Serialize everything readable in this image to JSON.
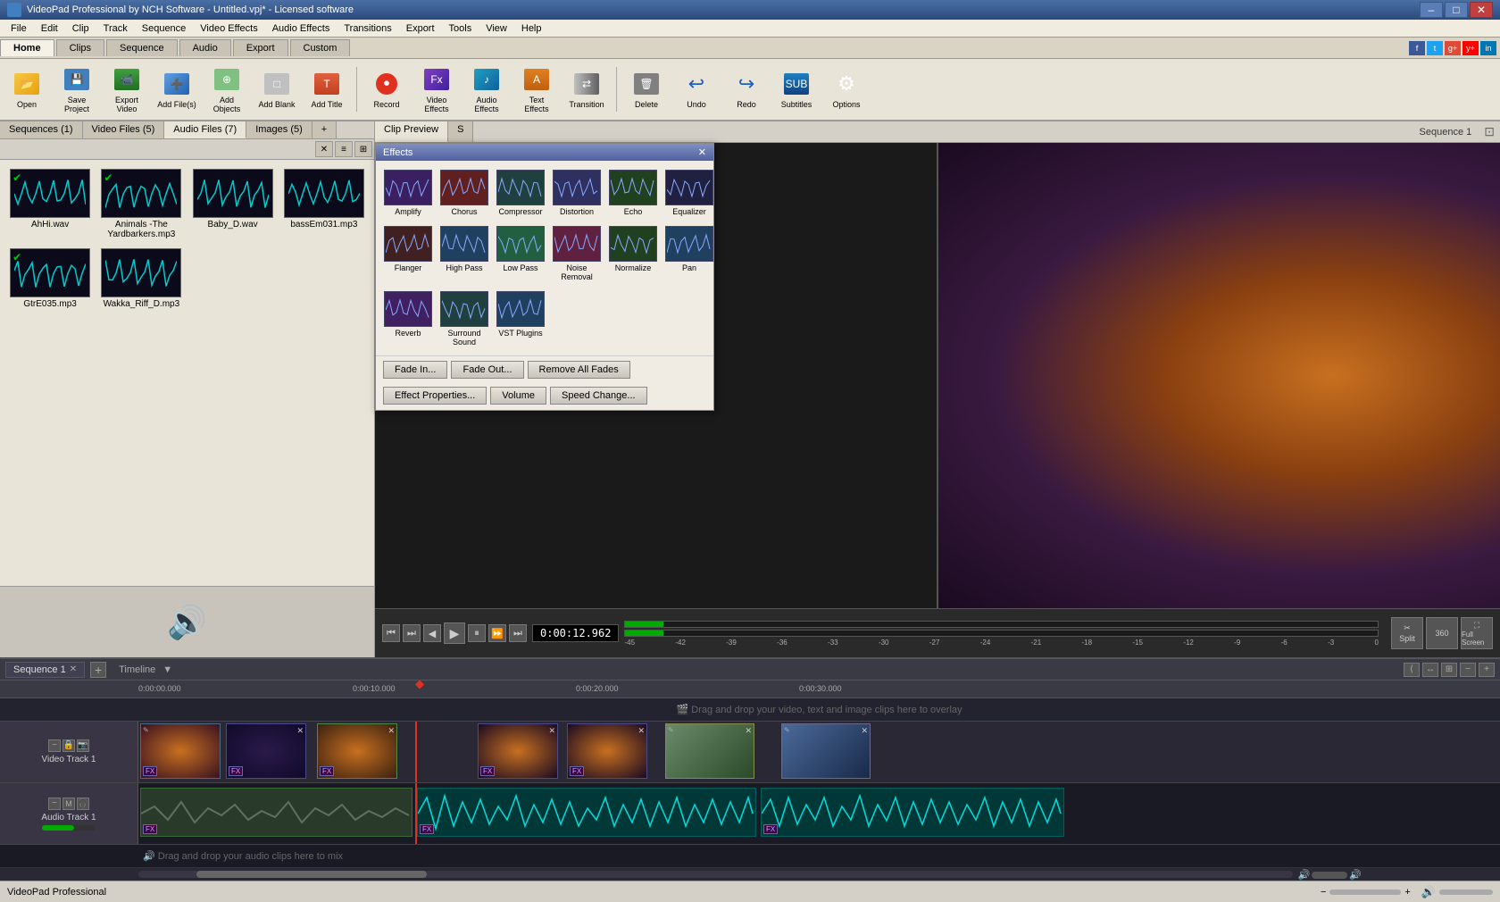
{
  "app": {
    "title": "VideoPad Professional by NCH Software - Untitled.vpj* - Licensed software",
    "status_text": "VideoPad Professional"
  },
  "titlebar": {
    "title": "VideoPad Professional by NCH Software - Untitled.vpj* - Licensed software",
    "min": "–",
    "max": "□",
    "close": "✕"
  },
  "menubar": {
    "items": [
      "File",
      "Edit",
      "Clip",
      "Track",
      "Sequence",
      "Video Effects",
      "Audio Effects",
      "Transitions",
      "Export",
      "Tools",
      "View",
      "Help"
    ]
  },
  "toolbar_tabs": {
    "tabs": [
      "Home",
      "Clips",
      "Sequence",
      "Audio",
      "Export",
      "Custom"
    ],
    "active": "Home"
  },
  "toolbar": {
    "buttons": [
      {
        "id": "open",
        "label": "Open",
        "icon": "open"
      },
      {
        "id": "save-project",
        "label": "Save Project",
        "icon": "save"
      },
      {
        "id": "export-video",
        "label": "Export Video",
        "icon": "export-v"
      },
      {
        "id": "add-files",
        "label": "Add File(s)",
        "icon": "add-files"
      },
      {
        "id": "add-objects",
        "label": "Add Objects",
        "icon": "add-obj"
      },
      {
        "id": "add-blank",
        "label": "Add Blank",
        "icon": "add-blank"
      },
      {
        "id": "add-title",
        "label": "Add Title",
        "icon": "add-title"
      },
      {
        "id": "record",
        "label": "Record",
        "icon": "record"
      },
      {
        "id": "video-effects",
        "label": "Video Effects",
        "icon": "video-fx"
      },
      {
        "id": "audio-effects",
        "label": "Audio Effects",
        "icon": "audio-fx"
      },
      {
        "id": "text-effects",
        "label": "Text Effects",
        "icon": "text-fx"
      },
      {
        "id": "transition",
        "label": "Transition",
        "icon": "transition"
      },
      {
        "id": "delete",
        "label": "Delete",
        "icon": "delete"
      },
      {
        "id": "undo",
        "label": "Undo",
        "icon": "undo"
      },
      {
        "id": "redo",
        "label": "Redo",
        "icon": "redo"
      },
      {
        "id": "subtitles",
        "label": "Subtitles",
        "icon": "subtitles"
      },
      {
        "id": "options",
        "label": "Options",
        "icon": "options"
      }
    ]
  },
  "file_panel": {
    "tabs": [
      {
        "id": "sequences",
        "label": "Sequences (1)"
      },
      {
        "id": "video-files",
        "label": "Video Files (5)"
      },
      {
        "id": "audio-files",
        "label": "Audio Files (7)",
        "active": true
      },
      {
        "id": "images",
        "label": "Images (5)"
      },
      {
        "id": "add",
        "label": "+"
      }
    ],
    "files": [
      {
        "name": "AhHi.wav",
        "type": "audio",
        "checked": true
      },
      {
        "name": "Animals -The Yardbarkers.mp3",
        "type": "audio",
        "checked": true
      },
      {
        "name": "Baby_D.wav",
        "type": "audio",
        "checked": false
      },
      {
        "name": "bassEm031.mp3",
        "type": "audio",
        "checked": false
      },
      {
        "name": "GtrE035.mp3",
        "type": "audio",
        "checked": true
      },
      {
        "name": "Wakka_Riff_D.mp3",
        "type": "audio",
        "checked": false
      }
    ]
  },
  "effects_popup": {
    "title": "Effects",
    "effects": [
      {
        "name": "Amplify",
        "color": "#3a2060"
      },
      {
        "name": "Chorus",
        "color": "#602020"
      },
      {
        "name": "Compressor",
        "color": "#204040"
      },
      {
        "name": "Distortion",
        "color": "#303060"
      },
      {
        "name": "Echo",
        "color": "#204020"
      },
      {
        "name": "Equalizer",
        "color": "#202040"
      },
      {
        "name": "Flanger",
        "color": "#402020"
      },
      {
        "name": "High Pass",
        "color": "#204060"
      },
      {
        "name": "Low Pass",
        "color": "#206040"
      },
      {
        "name": "Noise Removal",
        "color": "#602040"
      },
      {
        "name": "Normalize",
        "color": "#204020"
      },
      {
        "name": "Pan",
        "color": "#204060"
      },
      {
        "name": "Reverb",
        "color": "#402060"
      },
      {
        "name": "Surround Sound",
        "color": "#204040"
      },
      {
        "name": "VST Plugins",
        "color": "#204060"
      }
    ],
    "buttons": {
      "fade_in": "Fade In...",
      "fade_out": "Fade Out...",
      "remove_fades": "Remove All Fades",
      "effect_props": "Effect Properties...",
      "volume": "Volume",
      "speed_change": "Speed Change..."
    }
  },
  "preview": {
    "tabs": [
      "Clip Preview",
      "S"
    ],
    "timecode": "0:00:12.962",
    "sequence_name": "Sequence 1"
  },
  "transport": {
    "timecode": "0:00:12.962",
    "buttons": [
      "⏮",
      "⏭",
      "◀",
      "▶",
      "⏯",
      "⏩",
      "⏭"
    ],
    "levels": [
      "-45",
      "-42",
      "-39",
      "-36",
      "-33",
      "-30",
      "-27",
      "-24",
      "-21",
      "-18",
      "-15",
      "-12",
      "-9",
      "-6",
      "-3",
      "0"
    ]
  },
  "timeline": {
    "sequence_label": "Sequence 1",
    "ruler_marks": [
      "0:00:00.000",
      "0:00:10.000",
      "0:00:20.000",
      "0:00:30.000"
    ],
    "tracks": [
      {
        "type": "video",
        "label": "Video Track 1",
        "drop_hint": "Drag and drop your video, text and image clips here to overlay"
      },
      {
        "type": "audio",
        "label": "Audio Track 1",
        "drop_hint": "Drag and drop your audio clips here to mix"
      }
    ],
    "playhead_pos": "0:00:12.962"
  }
}
